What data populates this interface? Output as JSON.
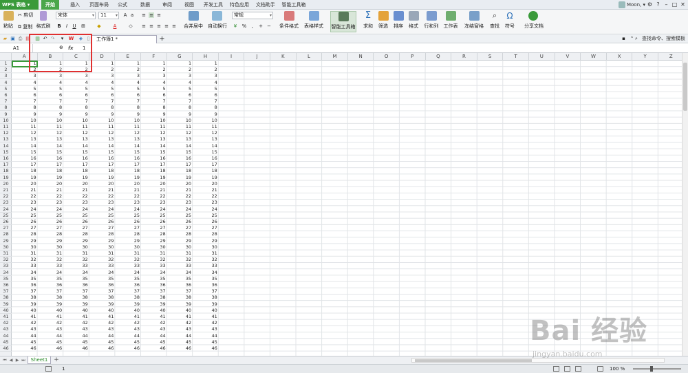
{
  "app": {
    "title": "WPS 表格"
  },
  "tabs": [
    "开始",
    "插入",
    "页面布局",
    "公式",
    "数据",
    "审阅",
    "视图",
    "开发工具",
    "特色应用",
    "文档助手",
    "智能工具箱"
  ],
  "user": {
    "name": "Moon,"
  },
  "ribbon": {
    "paste": "粘贴",
    "cut": "剪切",
    "copy": "复制",
    "format_painter": "格式刷",
    "font_name": "宋体",
    "font_size": "11",
    "bold": "B",
    "italic": "I",
    "underline": "U",
    "number_format": "常规",
    "merge_center": "合并居中",
    "wrap_text": "自动换行",
    "conditional_format": "条件格式",
    "table_style": "表格样式",
    "smart_toolbox": "智能工具箱",
    "sum": "求和",
    "filter": "筛选",
    "sort": "排序",
    "format": "格式",
    "rows_cols": "行和列",
    "worksheet": "工作表",
    "freeze": "冻结窗格",
    "find": "查找",
    "symbol": "符号",
    "share": "分享文档"
  },
  "document": {
    "tab_name": "工作簿1 *"
  },
  "search": {
    "label": "查找命令、搜索模板"
  },
  "formula": {
    "cell_ref": "A1",
    "fx": "fx",
    "value": "1"
  },
  "columns": [
    "A",
    "B",
    "C",
    "D",
    "E",
    "F",
    "G",
    "H",
    "I",
    "J",
    "K",
    "L",
    "M",
    "N",
    "O",
    "P",
    "Q",
    "R",
    "S",
    "T",
    "U",
    "V",
    "W",
    "X",
    "Y",
    "Z"
  ],
  "row_count": 46,
  "filled_columns": 8,
  "sheet": {
    "tabs": [
      "Sheet1"
    ]
  },
  "status": {
    "value": "1",
    "zoom": "100 %"
  },
  "watermark": {
    "brand": "Bai 经验",
    "url": "jingyan.baidu.com"
  },
  "colors": {
    "accent": "#4aa64a",
    "highlight": "#e03030"
  }
}
